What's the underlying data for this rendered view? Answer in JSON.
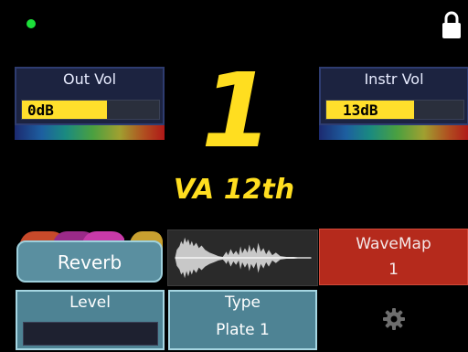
{
  "status": {
    "led_color": "#1ce03a"
  },
  "icons": {
    "lock": "lock-icon",
    "settings": "gear-icon"
  },
  "out_vol": {
    "label": "Out Vol",
    "value": "0dB",
    "level": 0.62
  },
  "instr_vol": {
    "label": "Instr Vol",
    "value": "13dB",
    "level": 0.64
  },
  "preset": {
    "number": "1",
    "name": "VA 12th"
  },
  "effect": {
    "label": "Reverb",
    "tab_colors": [
      "#c84a2a",
      "#9a2a88",
      "#c83aa8",
      "#c8a030"
    ]
  },
  "wavemap": {
    "label": "WaveMap",
    "value": "1"
  },
  "level": {
    "label": "Level",
    "value": 0
  },
  "type": {
    "label": "Type",
    "value": "Plate 1"
  },
  "colors": {
    "accent": "#ffde20",
    "wavemap_bg": "#b52a1c",
    "param_bg": "#4e8394"
  }
}
